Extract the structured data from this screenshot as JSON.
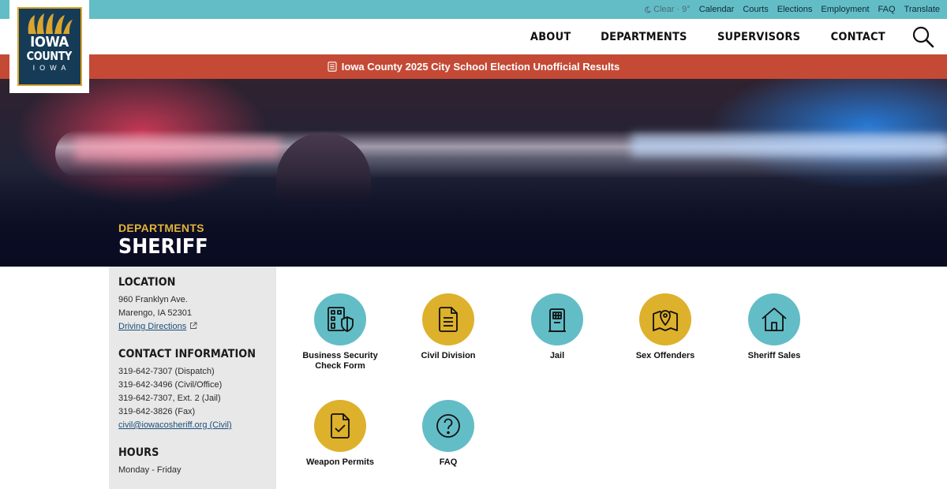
{
  "logo": {
    "line1": "IOWA",
    "line2": "COUNTY",
    "line3": "IOWA"
  },
  "utility": {
    "weather": "Clear · 9°",
    "links": [
      "Calendar",
      "Courts",
      "Elections",
      "Employment",
      "FAQ",
      "Translate"
    ]
  },
  "nav": {
    "items": [
      "ABOUT",
      "DEPARTMENTS",
      "SUPERVISORS",
      "CONTACT"
    ]
  },
  "alert": {
    "text": "Iowa County 2025 City School Election Unofficial Results"
  },
  "hero": {
    "breadcrumb": "DEPARTMENTS",
    "title": "SHERIFF"
  },
  "sidebar": {
    "location": {
      "heading": "LOCATION",
      "address1": "960 Franklyn Ave.",
      "address2": "Marengo, IA 52301",
      "directions": "Driving Directions"
    },
    "contact": {
      "heading": "CONTACT INFORMATION",
      "lines": [
        "319-642-7307 (Dispatch)",
        "319-642-3496 (Civil/Office)",
        "319-642-7307, Ext. 2 (Jail)",
        "319-642-3826 (Fax)"
      ],
      "email": "civil@iowacosheriff.org (Civil)"
    },
    "hours": {
      "heading": "HOURS",
      "line": "Monday - Friday"
    }
  },
  "tiles": [
    {
      "label": "Business Security Check Form",
      "icon": "building-shield-icon",
      "color": "#63bdc6"
    },
    {
      "label": "Civil Division",
      "icon": "document-icon",
      "color": "#ddb12b"
    },
    {
      "label": "Jail",
      "icon": "jail-door-icon",
      "color": "#63bdc6"
    },
    {
      "label": "Sex Offenders",
      "icon": "map-pin-icon",
      "color": "#ddb12b"
    },
    {
      "label": "Sheriff Sales",
      "icon": "house-icon",
      "color": "#63bdc6"
    },
    {
      "label": "Weapon Permits",
      "icon": "document-check-icon",
      "color": "#ddb12b"
    },
    {
      "label": "FAQ",
      "icon": "question-icon",
      "color": "#63bdc6"
    }
  ]
}
